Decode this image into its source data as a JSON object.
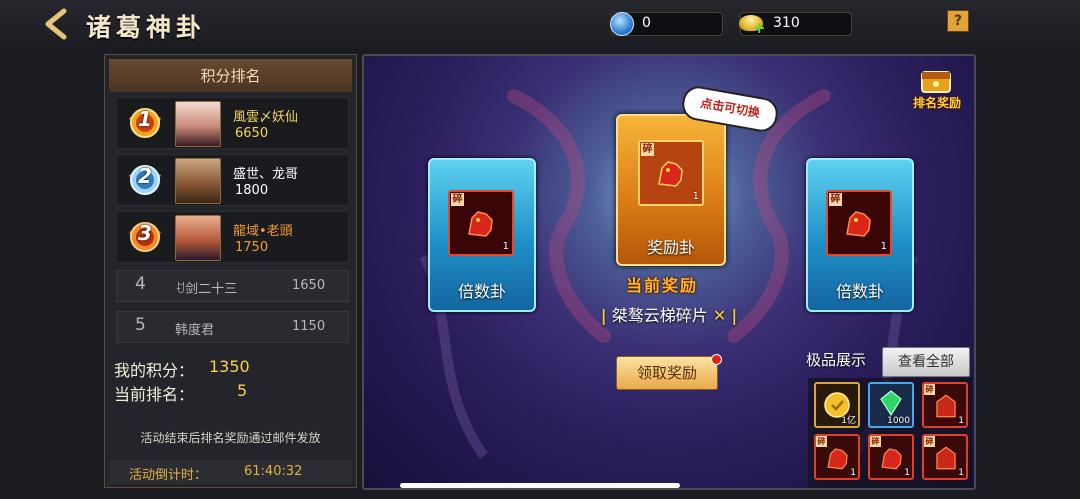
{
  "header": {
    "title": "诸葛神卦",
    "resource_a_value": "0",
    "resource_b_value": "310",
    "help_label": "?"
  },
  "ranking": {
    "title": "积分排名",
    "top": [
      {
        "rank": "1",
        "name": "風雲〆妖仙",
        "score": "6650",
        "name_color": "#f3d35a",
        "score_color": "#f3d35a"
      },
      {
        "rank": "2",
        "name": "盛世、龙哥",
        "score": "1800",
        "name_color": "#ffffff",
        "score_color": "#ffffff"
      },
      {
        "rank": "3",
        "name": "龍域•老頭",
        "score": "1750",
        "name_color": "#f39a2a",
        "score_color": "#f39a2a"
      }
    ],
    "others": [
      {
        "rank": "4",
        "name": "ꀀ剑二十三",
        "score": "1650"
      },
      {
        "rank": "5",
        "name": "韩度君",
        "score": "1150"
      }
    ],
    "my_score_label": "我的积分：",
    "my_score": "1350",
    "my_rank_label": "当前排名：",
    "my_rank": "5",
    "notice": "活动结束后排名奖励通过邮件发放",
    "countdown_label": "活动倒计时：",
    "countdown": "61:40:32"
  },
  "divination": {
    "left_card_label": "倍数卦",
    "left_card_qty": "1",
    "center_card_label": "奖励卦",
    "center_card_qty": "1",
    "right_card_label": "倍数卦",
    "right_card_qty": "1",
    "fragment_tag": "碎",
    "switch_hint": "点击可切换",
    "current_reward_label": "当前奖励",
    "reward_name": "桀骜云梯碎片",
    "claim_label": "领取奖励",
    "rank_reward_label": "排名奖励"
  },
  "showcase": {
    "title": "极品展示",
    "view_all": "查看全部",
    "items": [
      {
        "qty": "1亿",
        "kind": "gold-coin"
      },
      {
        "qty": "1000",
        "kind": "jade"
      },
      {
        "qty": "1",
        "kind": "fragment"
      },
      {
        "qty": "1",
        "kind": "fragment"
      },
      {
        "qty": "1",
        "kind": "fragment"
      },
      {
        "qty": "1",
        "kind": "fragment"
      }
    ]
  }
}
